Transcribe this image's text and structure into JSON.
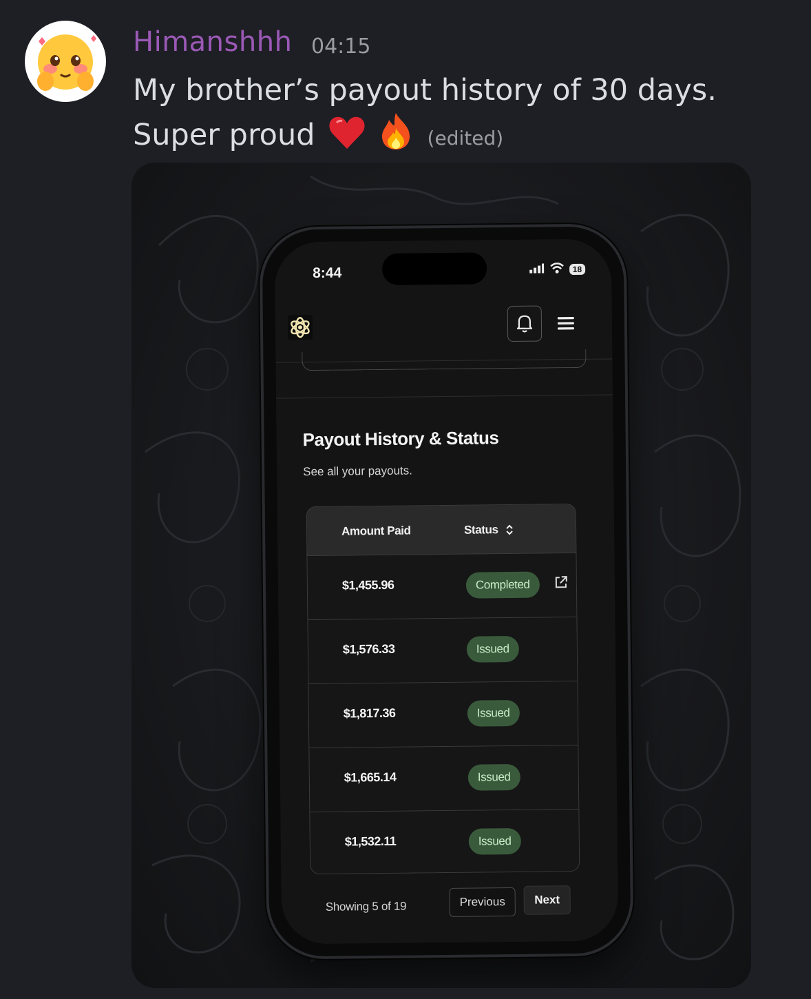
{
  "message": {
    "username": "Himanshhh",
    "timestamp": "04:15",
    "text": "My brother’s payout history of 30 days. Super proud",
    "edited_label": "(edited)",
    "emojis": [
      "heart-emoji",
      "fire-emoji"
    ],
    "username_color": "#9b59b6"
  },
  "phone": {
    "status_bar": {
      "time": "8:44",
      "battery": "18"
    },
    "section": {
      "title": "Payout History & Status",
      "subtitle": "See all your payouts."
    },
    "table": {
      "columns": [
        "Amount Paid",
        "Status"
      ],
      "rows": [
        {
          "amount": "$1,455.96",
          "status": "Completed"
        },
        {
          "amount": "$1,576.33",
          "status": "Issued"
        },
        {
          "amount": "$1,817.36",
          "status": "Issued"
        },
        {
          "amount": "$1,665.14",
          "status": "Issued"
        },
        {
          "amount": "$1,532.11",
          "status": "Issued"
        }
      ]
    },
    "pagination": {
      "showing": "Showing 5 of 19",
      "previous": "Previous",
      "next": "Next"
    },
    "colors": {
      "status_pill_bg": "#3a5a3c",
      "status_pill_text": "#c9ecc6"
    },
    "icons": [
      "app-logo-icon",
      "bell-icon",
      "menu-icon",
      "sort-icon",
      "external-link-icon"
    ]
  }
}
